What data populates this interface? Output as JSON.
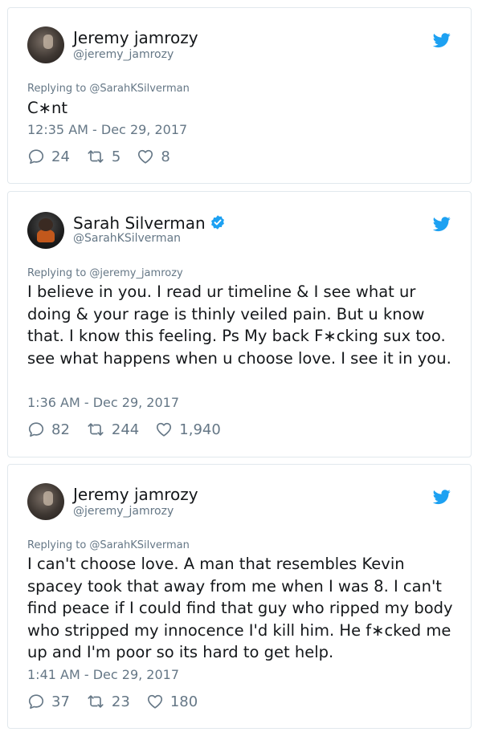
{
  "tweets": [
    {
      "name": "Jeremy jamrozy",
      "handle": "@jeremy_jamrozy",
      "verified": false,
      "replying_to": "Replying to @SarahKSilverman",
      "text": "C∗nt",
      "time": "12:35 AM - Dec 29, 2017",
      "replies": "24",
      "retweets": "5",
      "likes": "8"
    },
    {
      "name": "Sarah Silverman",
      "handle": "@SarahKSilverman",
      "verified": true,
      "replying_to": "Replying to @jeremy_jamrozy",
      "text": "I believe in you. I read ur timeline & I see what ur doing & your rage is thinly veiled pain. But u know that. I know this feeling. Ps My back F∗cking sux too. see what happens when u choose love. I see it in you.",
      "time": "1:36 AM - Dec 29, 2017",
      "replies": "82",
      "retweets": "244",
      "likes": "1,940"
    },
    {
      "name": "Jeremy jamrozy",
      "handle": "@jeremy_jamrozy",
      "verified": false,
      "replying_to": "Replying to @SarahKSilverman",
      "text": "I can't choose love. A man that resembles Kevin spacey took that away from me when I was 8. I can't find peace if I could find that guy who ripped my body who stripped my innocence I'd kill him. He f∗cked me up and I'm poor so its hard to get help.",
      "time": "1:41 AM - Dec 29, 2017",
      "replies": "37",
      "retweets": "23",
      "likes": "180"
    }
  ],
  "colors": {
    "text": "#14171a",
    "muted": "#657786",
    "border": "#e1e8ed",
    "twitter_blue": "#1da1f2"
  },
  "icons": [
    "twitter-bird-icon",
    "verified-badge-icon",
    "reply-icon",
    "retweet-icon",
    "like-icon"
  ]
}
